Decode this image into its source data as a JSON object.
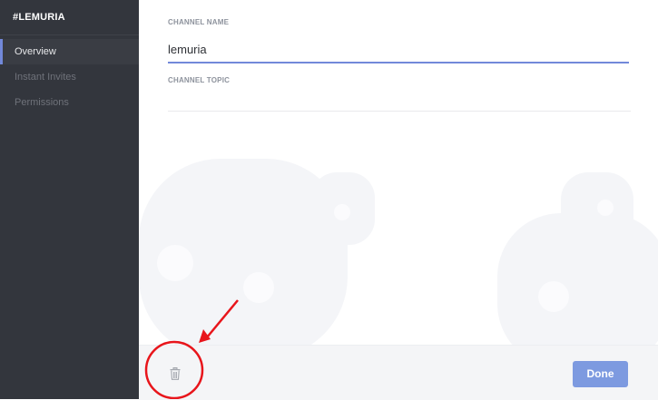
{
  "sidebar": {
    "title": "#LEMURIA",
    "items": [
      {
        "label": "Overview",
        "active": true
      },
      {
        "label": "Instant Invites",
        "active": false
      },
      {
        "label": "Permissions",
        "active": false
      }
    ]
  },
  "main": {
    "channel_name_label": "CHANNEL NAME",
    "channel_name_value": "lemuria",
    "channel_topic_label": "CHANNEL TOPIC",
    "channel_topic_value": ""
  },
  "footer": {
    "delete_icon": "trash-icon",
    "done_label": "Done"
  },
  "colors": {
    "accent": "#7289da",
    "done_button": "#7d9ae0",
    "annotation": "#e8151b"
  }
}
